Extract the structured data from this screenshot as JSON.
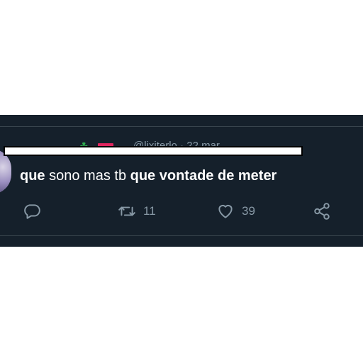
{
  "tweet": {
    "header": {
      "partial_text": "@lixiterlo · 22 mar"
    },
    "text_parts": [
      {
        "text": "que",
        "bold": true
      },
      {
        "text": " sono mas tb ",
        "bold": false
      },
      {
        "text": "que vontade de meter",
        "bold": true
      }
    ],
    "actions": {
      "reply": {
        "icon": "reply-icon"
      },
      "retweet": {
        "icon": "retweet-icon",
        "count": "11"
      },
      "like": {
        "icon": "heart-icon",
        "count": "39"
      },
      "share": {
        "icon": "share-icon"
      }
    }
  },
  "colors": {
    "background": "#15202b",
    "text": "#ffffff",
    "muted": "#8899a6",
    "divider": "#38444d"
  }
}
